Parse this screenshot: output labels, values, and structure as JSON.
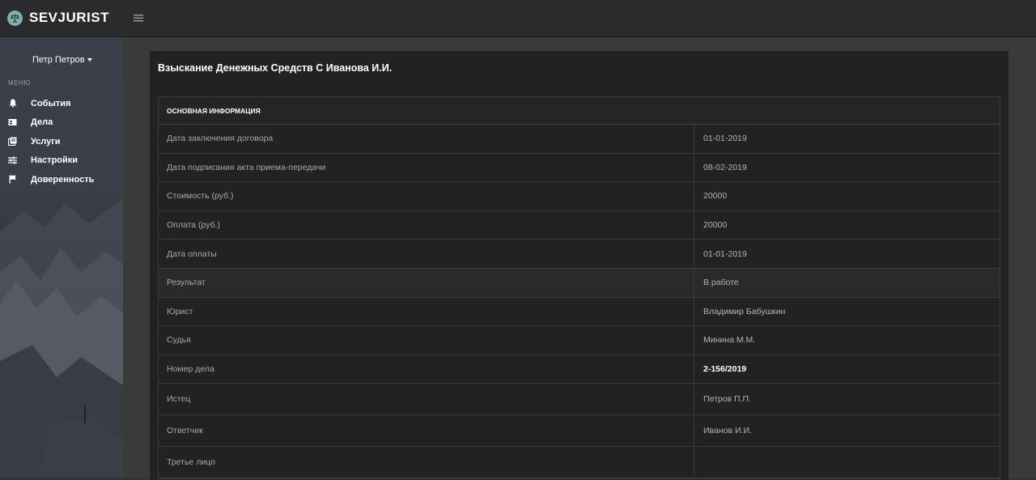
{
  "header": {
    "brand": "SEVJURIST"
  },
  "sidebar": {
    "user_name": "Петр Петров",
    "menu_title": "МЕНЮ",
    "items": [
      {
        "label": "События",
        "icon": "bell-icon"
      },
      {
        "label": "Дела",
        "icon": "case-icon"
      },
      {
        "label": "Услуги",
        "icon": "services-icon"
      },
      {
        "label": "Настройки",
        "icon": "sliders-icon"
      },
      {
        "label": "Доверенность",
        "icon": "flag-icon"
      }
    ]
  },
  "main": {
    "title": "Взыскание Денежных Средств С Иванова И.И.",
    "section_title": "ОСНОВНАЯ ИНФОРМАЦИЯ",
    "rows": [
      {
        "label": "Дата заключения договора",
        "value": "01-01-2019"
      },
      {
        "label": "Дата подписания акта приема-передачи",
        "value": "08-02-2019"
      },
      {
        "label": "Стоимость (руб.)",
        "value": "20000"
      },
      {
        "label": "Оплата (руб.)",
        "value": "20000"
      },
      {
        "label": "Дата оплаты",
        "value": "01-01-2019"
      },
      {
        "label": "Результат",
        "value": "В работе"
      },
      {
        "label": "Юрист",
        "value": "Владимир Бабушкин"
      },
      {
        "label": "Судья",
        "value": "Минина М.М."
      },
      {
        "label": "Номер дела",
        "value": "2-156/2019"
      },
      {
        "label": "Истец",
        "value": "Петров П.П."
      },
      {
        "label": "Ответчик",
        "value": "Иванов И.И."
      },
      {
        "label": "Третье лицо",
        "value": ""
      }
    ]
  },
  "colors": {
    "topbar": "#2b2b2d",
    "card": "#222222",
    "logo": "#7fb1ad"
  }
}
